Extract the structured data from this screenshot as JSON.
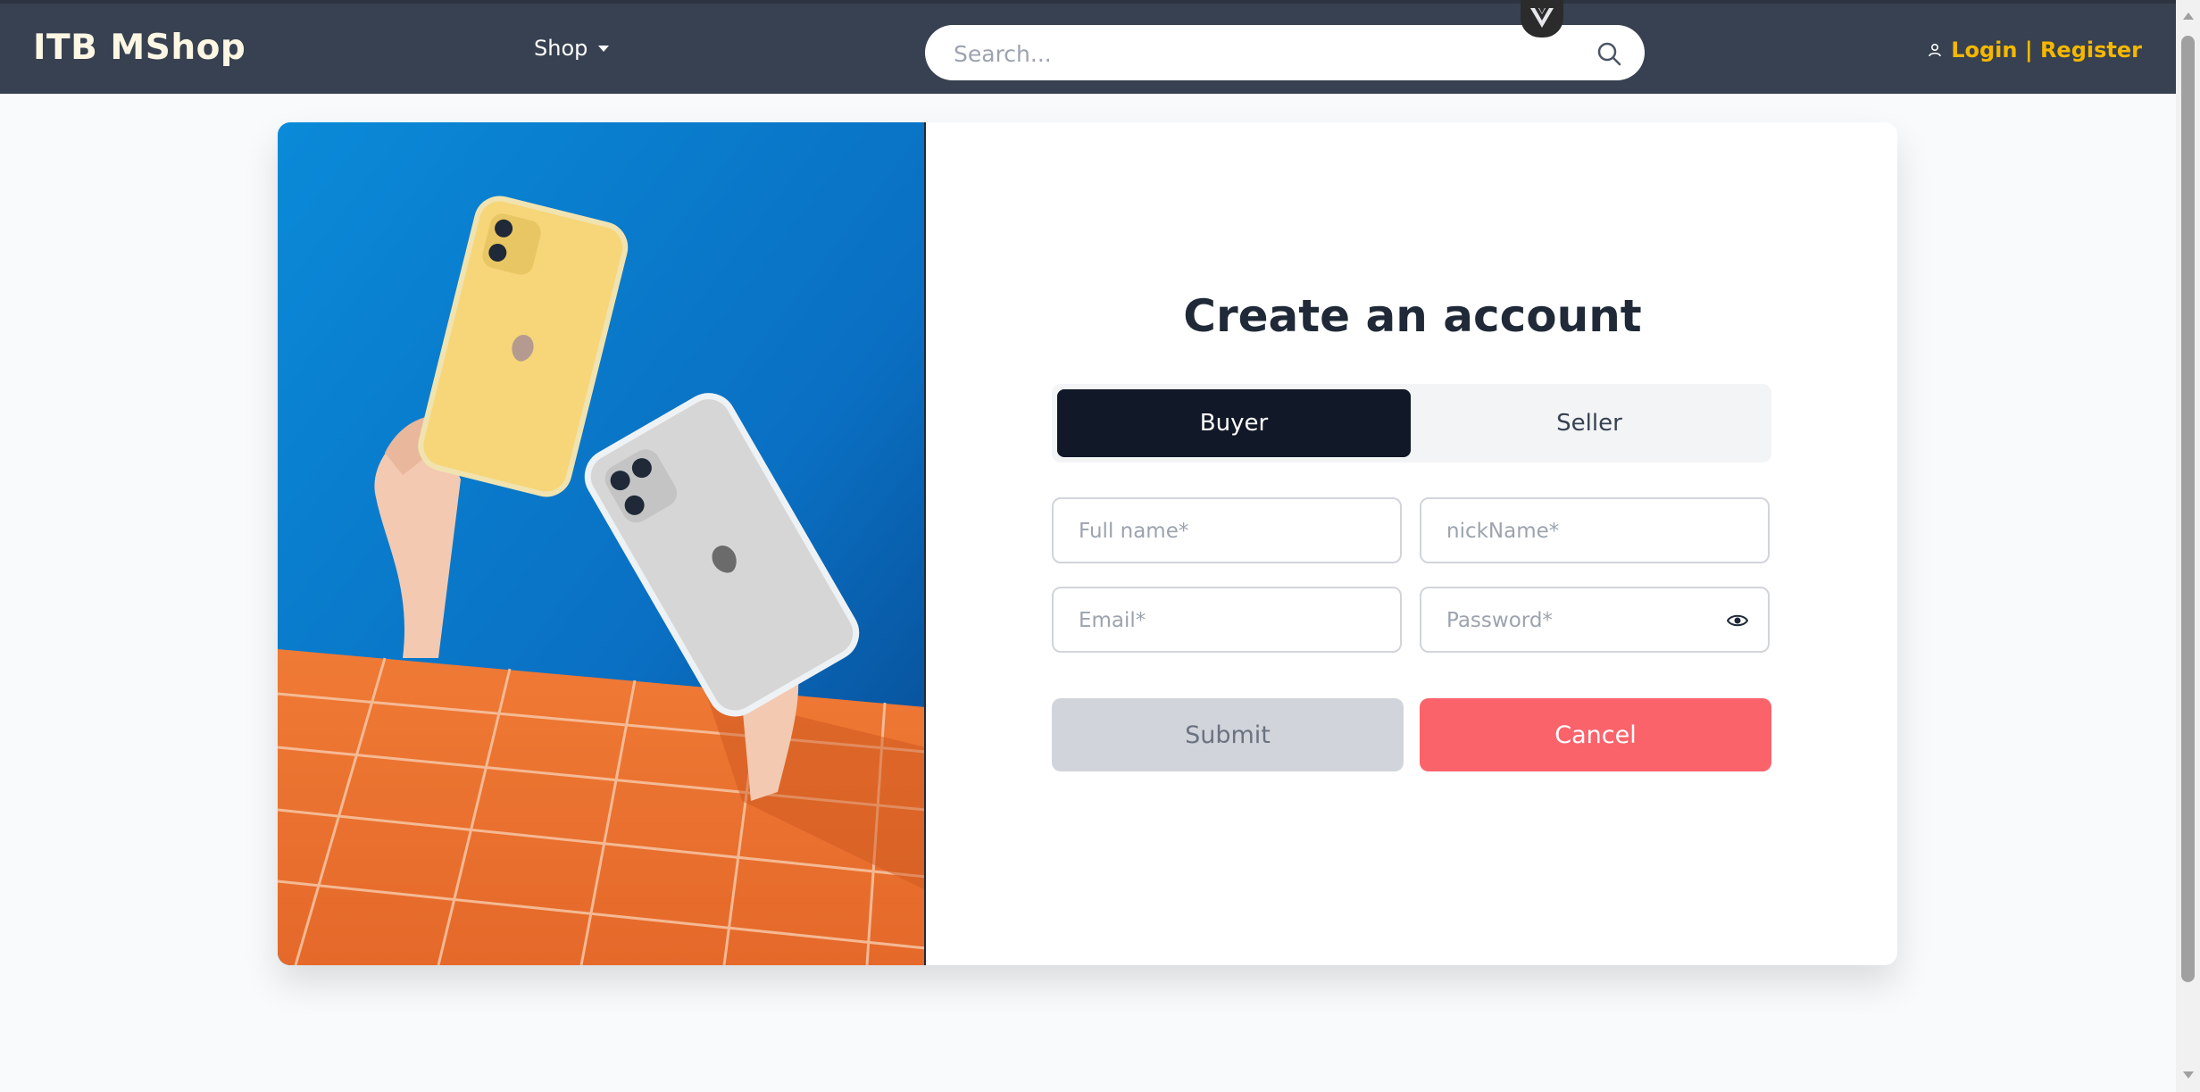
{
  "navbar": {
    "brand": "ITB MShop",
    "shop_menu": "Shop",
    "search_placeholder": "Search...",
    "auth_label": "Login | Register"
  },
  "form": {
    "title": "Create an account",
    "roles": [
      "Buyer",
      "Seller"
    ],
    "selected_role": "Buyer",
    "fields": {
      "full_name_placeholder": "Full name*",
      "nickname_placeholder": "nickName*",
      "email_placeholder": "Email*",
      "password_placeholder": "Password*"
    },
    "submit_label": "Submit",
    "cancel_label": "Cancel"
  },
  "colors": {
    "navbar_bg": "#374151",
    "brand_text": "#fdf6e3",
    "auth_accent": "#f5b800",
    "selected_role_bg": "#111827",
    "submit_bg": "#d1d5db",
    "cancel_bg": "#fb636b"
  },
  "icons": [
    "search-icon",
    "vue-devtools-icon",
    "user-icon",
    "caret-down-icon",
    "eye-icon"
  ]
}
